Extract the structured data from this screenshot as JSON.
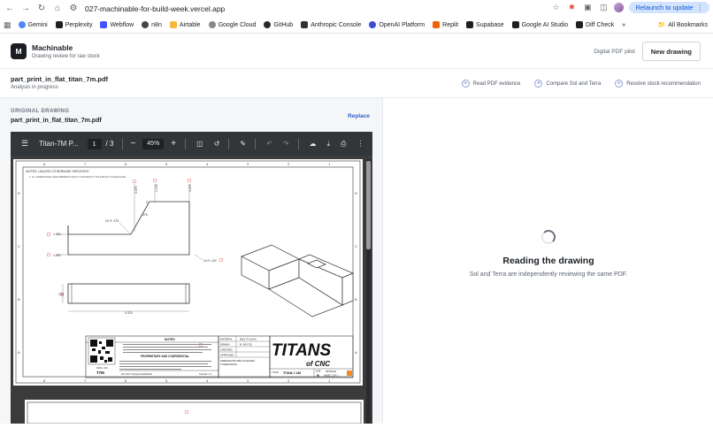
{
  "browser": {
    "url": "027-machinable-for-build-week.vercel.app",
    "relaunch_label": "Relaunch to update",
    "bookmarks": [
      {
        "label": "Gemini",
        "color": "#4f86f7"
      },
      {
        "label": "Perplexity",
        "color": "#1f1f1f"
      },
      {
        "label": "Webflow",
        "color": "#4353ff"
      },
      {
        "label": "n8n",
        "color": "#444444"
      },
      {
        "label": "Airtable",
        "color": "#f6b93b"
      },
      {
        "label": "Google Cloud",
        "color": "#888888"
      },
      {
        "label": "GitHub",
        "color": "#24292f"
      },
      {
        "label": "Anthropic Console",
        "color": "#333333"
      },
      {
        "label": "OpenAI Platform",
        "color": "#3b4bd6"
      },
      {
        "label": "Replit",
        "color": "#f26207"
      },
      {
        "label": "Supabase",
        "color": "#1f1f1f"
      },
      {
        "label": "Google AI Studio",
        "color": "#1f1f1f"
      },
      {
        "label": "Diff Check",
        "color": "#1f1f1f"
      }
    ],
    "all_bookmarks_label": "All Bookmarks"
  },
  "app": {
    "logo_letter": "M",
    "name": "Machinable",
    "subtitle": "Drawing review for raw stock",
    "pilot_label": "Digital PDF pilot",
    "new_drawing_label": "New drawing"
  },
  "review": {
    "file_name": "part_print_in_flat_titan_7m.pdf",
    "status": "Analysis in progress",
    "actions": [
      {
        "label": "Read PDF evidence"
      },
      {
        "label": "Compare Sol and Terra"
      },
      {
        "label": "Resolve stock recommendation"
      }
    ]
  },
  "original": {
    "section_label": "ORIGINAL DRAWING",
    "file_name": "part_print_in_flat_titan_7m.pdf",
    "replace_label": "Replace"
  },
  "viewer": {
    "doc_name": "Titan-7M P...",
    "page": "1",
    "total_pages": "/ 3",
    "zoom": "45%"
  },
  "drawing": {
    "notes_header": "NOTES: UNLESS OTHERWISE SPECIFIED",
    "note_1": "1.   ALL DIMENSIONAL REQUIREMENTS MUST CONFORM TO TITLE BLOCK TOLERANCES",
    "dims": {
      "d1": "2.375",
      "d2": "1.125",
      "d3": "3.375",
      "d4": "0",
      "d5": "2X R .375",
      "d6": ".475",
      "d7": "1.200",
      "d8": "1.900",
      "d9": "2x R .100",
      "d10": ".730",
      "d11": "4.375"
    },
    "notes_title": "NOTES",
    "proprietary": "PROPRIETARY AND CONFIDENTIAL",
    "dwg_no_label": "DWG. NO.",
    "dwg_no": "T7M",
    "do_not_scale": "DO NOT SCALE DRAWING",
    "scale": "SCALE: 1:1",
    "material_label": "MATERIAL",
    "material": "6061 T6 ALUM",
    "drawn_label": "DRAWN",
    "drawn": "M. BOYCE",
    "checked_label": "CHECKED",
    "approved_label": "APPROVED",
    "dims_label": "DIMENSIONS ARE IN INCHES",
    "tol_label": "TOLERANCES:",
    "titans": "TITANS",
    "of_cnc": "of CNC",
    "title_label": "TITLE:",
    "title_value": "TITAN-7-1M",
    "size_label": "SIZE",
    "size": "B",
    "sheet": "SHEET 1 OF 3",
    "date": "08/15/2023",
    "col_labels": [
      "8",
      "7",
      "6",
      "5",
      "4",
      "3",
      "2",
      "1"
    ],
    "row_labels": [
      "D",
      "C",
      "B",
      "A"
    ]
  },
  "status_panel": {
    "heading": "Reading the drawing",
    "subtext": "Sol and Terra are independently reviewing the same PDF."
  }
}
